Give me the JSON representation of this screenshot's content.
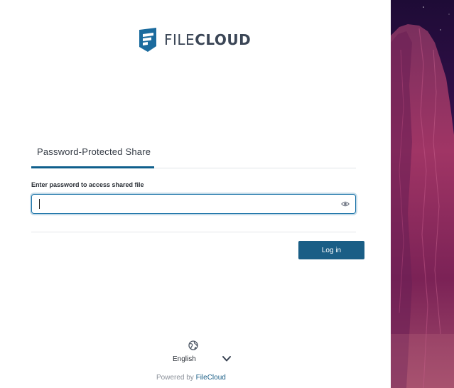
{
  "brand": {
    "name_light": "FILE",
    "name_bold": "CLOUD",
    "logo_icon": "filecloud-shield-icon",
    "accent_color": "#1a5e86"
  },
  "tabs": [
    {
      "label": "Password-Protected Share",
      "active": true
    }
  ],
  "form": {
    "password_label": "Enter password to access shared file",
    "password_value": "",
    "password_placeholder": "",
    "reveal_icon": "eye-icon",
    "submit_label": "Log in"
  },
  "footer": {
    "language_icon": "globe-icon",
    "language_selected": "English",
    "powered_by_prefix": "Powered by",
    "powered_by_brand": "FileCloud"
  },
  "background": {
    "description_colors": [
      "#2a0f3f",
      "#6a1a5e",
      "#a03a63"
    ]
  }
}
